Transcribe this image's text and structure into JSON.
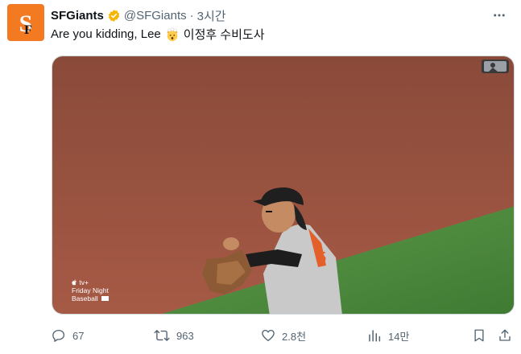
{
  "tweet": {
    "display_name": "SFGiants",
    "handle": "@SFGiants",
    "separator": "·",
    "time": "3시간",
    "text_before_emoji": "Are you kidding, Lee",
    "text_after_emoji": "이정후 수비도사",
    "emoji_icon": "exploding-head-icon",
    "avatar_icon": "sf-giants-logo-icon"
  },
  "media": {
    "watermark_line1": "tv+",
    "watermark_line2": "Friday Night",
    "watermark_line3": "Baseball",
    "corner_logo_icon": "mlb-logo-icon"
  },
  "actions": {
    "replies": "67",
    "retweets": "963",
    "likes": "2.8천",
    "views": "14만"
  },
  "colors": {
    "brand": "#f47a22",
    "text": "#0f1419",
    "muted": "#536471",
    "verified": "#f7b500"
  }
}
